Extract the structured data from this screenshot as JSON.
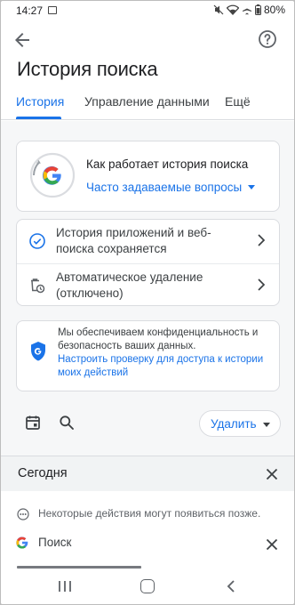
{
  "status_bar": {
    "time": "14:27",
    "battery": "80%"
  },
  "header": {
    "title": "История поиска"
  },
  "tabs": [
    {
      "label": "История",
      "active": true
    },
    {
      "label": "Управление данными",
      "active": false
    },
    {
      "label": "Ещё",
      "active": false
    }
  ],
  "cards": {
    "how_it_works": {
      "title": "Как работает история поиска",
      "link": "Часто задаваемые вопросы"
    },
    "settings": [
      {
        "text": "История приложений и веб-поиска сохраняется",
        "icon": "check-circle-icon"
      },
      {
        "text": "Автоматическое удаление (отключено)",
        "icon": "auto-delete-icon"
      }
    ],
    "privacy": {
      "text": "Мы обеспечиваем конфиденциальность и безопасность ваших данных.",
      "link": "Настроить проверку для доступа к истории моих действий"
    }
  },
  "toolbar": {
    "delete_label": "Удалить"
  },
  "history": {
    "section_label": "Сегодня",
    "info_text": "Некоторые действия могут появиться позже.",
    "items": [
      {
        "label": "Поиск"
      }
    ]
  },
  "colors": {
    "accent": "#1a73e8",
    "text": "#202124",
    "secondary_text": "#5f6368"
  }
}
